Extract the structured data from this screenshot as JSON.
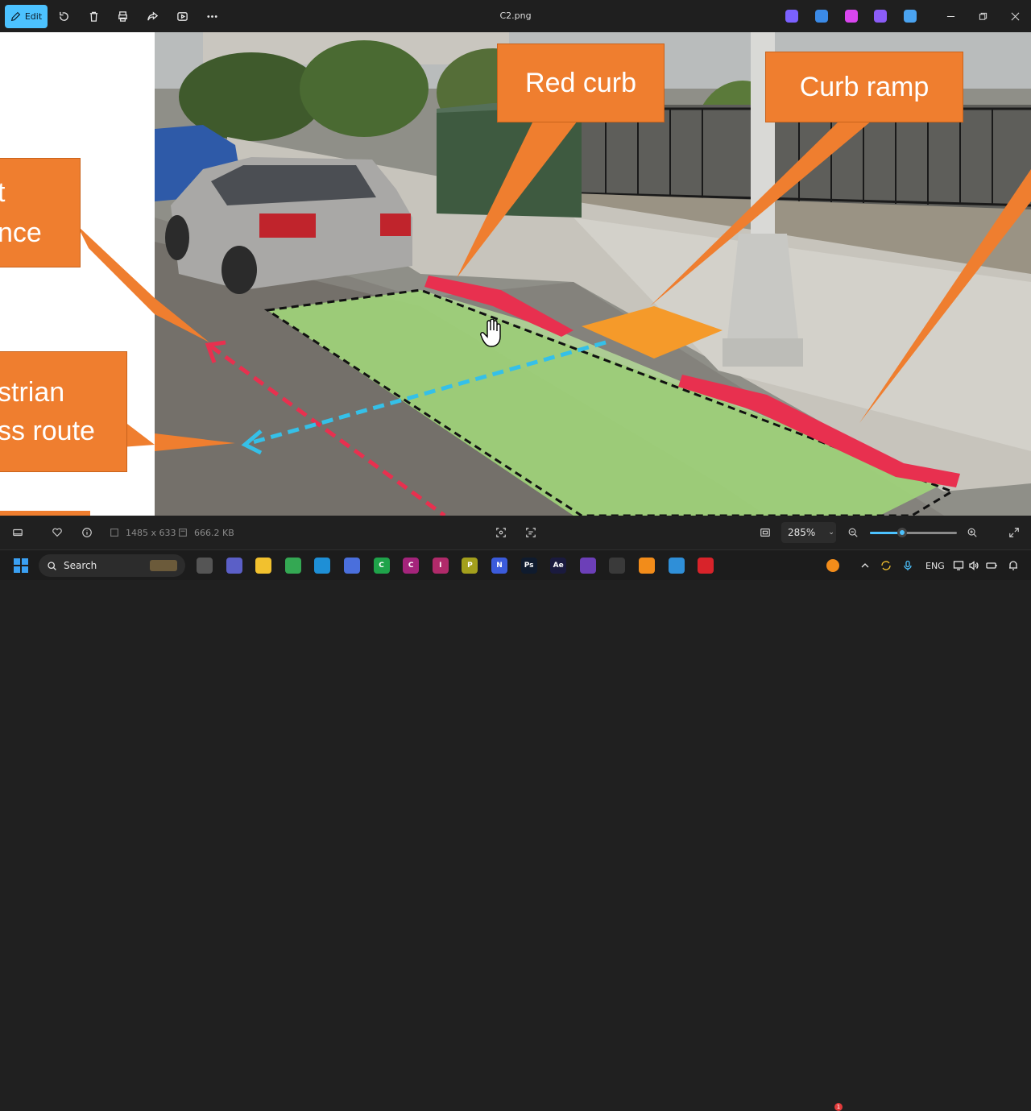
{
  "titlebar": {
    "edit_label": "Edit",
    "file_name": "C2.png",
    "tools": [
      "rotate-icon",
      "delete-icon",
      "print-icon",
      "share-icon",
      "slideshow-icon",
      "more-icon"
    ],
    "apps": [
      {
        "name": "copilot-icon",
        "color": "#7b61ff"
      },
      {
        "name": "photos-editor-icon",
        "color": "#3b8ae6"
      },
      {
        "name": "designer-icon",
        "color": "#d946ef"
      },
      {
        "name": "clipchamp-icon",
        "color": "#8b5cf6"
      },
      {
        "name": "onedrive-off-icon",
        "color": "#4aa3f0"
      }
    ]
  },
  "annotations": {
    "red_curb": "Red curb",
    "curb_ramp": "Curb ramp",
    "left_top_line1": "t",
    "left_top_line2": "nce",
    "pedestrian_line1": "strian",
    "pedestrian_line2": "ss route"
  },
  "colors": {
    "accent": "#4cc2ff",
    "callout": "#ef7e2f",
    "green_zone": "#9fd27a",
    "red_curb": "#e8304f",
    "ramp": "#f59a2a"
  },
  "statusbar": {
    "dimensions": "1485 x 633",
    "file_size": "666.2 KB",
    "zoom": "285%",
    "zoom_fraction": 0.37
  },
  "taskbar": {
    "search_label": "Search",
    "language": "ENG",
    "notification_count": "1",
    "apps": [
      {
        "name": "search-art-icon",
        "color": "#6b5a3a",
        "text": ""
      },
      {
        "name": "task-view-icon",
        "color": "#555555",
        "text": ""
      },
      {
        "name": "teams-icon",
        "color": "#5b5fc7",
        "text": ""
      },
      {
        "name": "file-explorer-icon",
        "color": "#f2c12e",
        "text": ""
      },
      {
        "name": "chrome-icon",
        "color": "#34a853",
        "text": ""
      },
      {
        "name": "edge-icon",
        "color": "#1e8fd6",
        "text": ""
      },
      {
        "name": "store-icon",
        "color": "#4a6fdc",
        "text": ""
      },
      {
        "name": "camtasia-icon",
        "color": "#1fa34a",
        "text": "C"
      },
      {
        "name": "captivate-icon",
        "color": "#a4247b",
        "text": "C"
      },
      {
        "name": "indesign-icon",
        "color": "#b02a6a",
        "text": "I"
      },
      {
        "name": "presenter-icon",
        "color": "#a39f1c",
        "text": "P"
      },
      {
        "name": "onenote-icon",
        "color": "#3b5bdb",
        "text": "N"
      },
      {
        "name": "photoshop-icon",
        "color": "#0f1b2e",
        "text": "Ps"
      },
      {
        "name": "after-effects-icon",
        "color": "#1a1a3e",
        "text": "Ae"
      },
      {
        "name": "visual-studio-icon",
        "color": "#6c3fb8",
        "text": ""
      },
      {
        "name": "pen-tool-icon",
        "color": "#3a3a3a",
        "text": ""
      },
      {
        "name": "vlc-icon",
        "color": "#f28c1a",
        "text": ""
      },
      {
        "name": "photos-icon",
        "color": "#2f8fd8",
        "text": ""
      },
      {
        "name": "camtasia-recorder-icon",
        "color": "#d8232a",
        "text": ""
      }
    ]
  }
}
